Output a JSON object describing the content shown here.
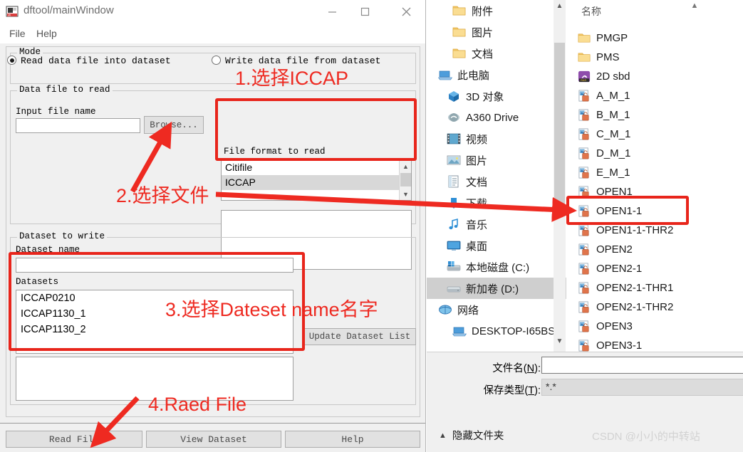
{
  "window": {
    "title": "dftool/mainWindow",
    "icon": "app-icon",
    "minimize": "—",
    "maximize": "☐",
    "close": "✕"
  },
  "menu": {
    "file": "File",
    "help": "Help"
  },
  "mode": {
    "group_title": "Mode",
    "read_label": "Read data file into dataset",
    "write_label": "Write data file from dataset",
    "read_checked": true,
    "write_checked": false
  },
  "datafile": {
    "group_title": "Data file to read",
    "input_label": "Input file name",
    "input_value": "",
    "browse_label": "Browse...",
    "format_label": "File format to read",
    "format_items": [
      "Citifile",
      "ICCAP"
    ],
    "format_selected": "ICCAP",
    "preview_value": ""
  },
  "dataset": {
    "group_title": "Dataset to write",
    "name_label": "Dataset name",
    "name_value": "",
    "datasets_label": "Datasets",
    "datasets": [
      "ICCAP0210",
      "ICCAP1130_1",
      "ICCAP1130_2"
    ],
    "update_label": "Update Dataset List",
    "output_value": ""
  },
  "bottom_buttons": {
    "read_file": "Read File",
    "view_dataset": "View Dataset",
    "help": "Help"
  },
  "explorer": {
    "tree": [
      {
        "label": "附件",
        "icon": "folder-icon",
        "indent": 36,
        "selected": false
      },
      {
        "label": "图片",
        "icon": "folder-icon",
        "indent": 36,
        "selected": false
      },
      {
        "label": "文档",
        "icon": "folder-icon",
        "indent": 36,
        "selected": false
      },
      {
        "label": "此电脑",
        "icon": "computer-icon",
        "indent": 16,
        "selected": false
      },
      {
        "label": "3D 对象",
        "icon": "cube-icon",
        "indent": 28,
        "selected": false
      },
      {
        "label": "A360 Drive",
        "icon": "cloud-icon",
        "indent": 28,
        "selected": false
      },
      {
        "label": "视频",
        "icon": "video-icon",
        "indent": 28,
        "selected": false
      },
      {
        "label": "图片",
        "icon": "picture-icon",
        "indent": 28,
        "selected": false
      },
      {
        "label": "文档",
        "icon": "document-icon",
        "indent": 28,
        "selected": false
      },
      {
        "label": "下载",
        "icon": "download-icon",
        "indent": 28,
        "selected": false
      },
      {
        "label": "音乐",
        "icon": "music-icon",
        "indent": 28,
        "selected": false
      },
      {
        "label": "桌面",
        "icon": "desktop-icon",
        "indent": 28,
        "selected": false
      },
      {
        "label": "本地磁盘 (C:)",
        "icon": "drive-windows-icon",
        "indent": 28,
        "selected": false
      },
      {
        "label": "新加卷 (D:)",
        "icon": "drive-icon",
        "indent": 28,
        "selected": true
      },
      {
        "label": "网络",
        "icon": "network-icon",
        "indent": 16,
        "selected": false
      },
      {
        "label": "DESKTOP-I65BS",
        "icon": "computer-icon",
        "indent": 36,
        "selected": false
      }
    ],
    "column_header": "名称",
    "files": [
      {
        "name": "PMGP",
        "icon": "folder-icon"
      },
      {
        "name": "PMS",
        "icon": "folder-icon"
      },
      {
        "name": "2D sbd",
        "icon": "rar-archive-icon"
      },
      {
        "name": "A_M_1",
        "icon": "data-file-icon"
      },
      {
        "name": "B_M_1",
        "icon": "data-file-icon"
      },
      {
        "name": "C_M_1",
        "icon": "data-file-icon"
      },
      {
        "name": "D_M_1",
        "icon": "data-file-icon"
      },
      {
        "name": "E_M_1",
        "icon": "data-file-icon"
      },
      {
        "name": "OPEN1",
        "icon": "data-file-icon"
      },
      {
        "name": "OPEN1-1",
        "icon": "data-file-icon"
      },
      {
        "name": "OPEN1-1-THR2",
        "icon": "data-file-icon"
      },
      {
        "name": "OPEN2",
        "icon": "data-file-icon"
      },
      {
        "name": "OPEN2-1",
        "icon": "data-file-icon"
      },
      {
        "name": "OPEN2-1-THR1",
        "icon": "data-file-icon"
      },
      {
        "name": "OPEN2-1-THR2",
        "icon": "data-file-icon"
      },
      {
        "name": "OPEN3",
        "icon": "data-file-icon"
      },
      {
        "name": "OPEN3-1",
        "icon": "data-file-icon"
      }
    ],
    "filename_label": "文件名(N):",
    "filename_value": "",
    "filetype_label": "保存类型(T):",
    "filetype_value": "*.*",
    "hide_folders": "隐藏文件夹",
    "watermark": "CSDN @小小的中转站"
  },
  "annotations": {
    "color": "#ee2a21",
    "step1": "1.选择ICCAP",
    "step2": "2.选择文件",
    "step3": "3.选择Dateset name名字",
    "step4": "4.Raed File"
  }
}
